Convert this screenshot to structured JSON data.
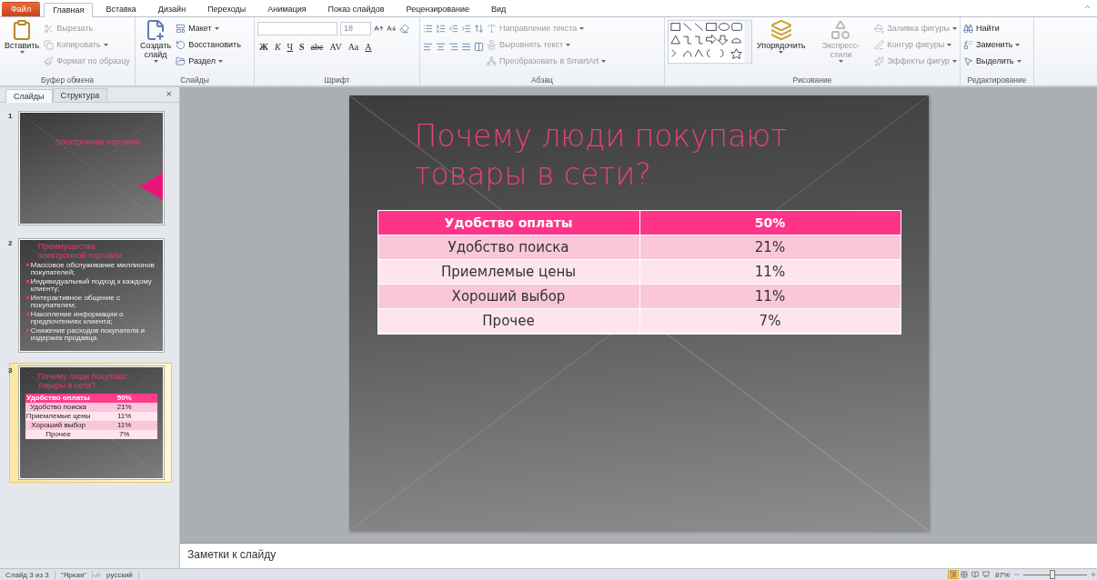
{
  "tabs": [
    {
      "label": "Файл",
      "kind": "file",
      "selected": false
    },
    {
      "label": "Главная",
      "kind": "tab",
      "selected": true
    },
    {
      "label": "Вставка",
      "kind": "tab",
      "selected": false
    },
    {
      "label": "Дизайн",
      "kind": "tab",
      "selected": false
    },
    {
      "label": "Переходы",
      "kind": "tab",
      "selected": false
    },
    {
      "label": "Анимация",
      "kind": "tab",
      "selected": false
    },
    {
      "label": "Показ слайдов",
      "kind": "tab",
      "selected": false
    },
    {
      "label": "Рецензирование",
      "kind": "tab",
      "selected": false
    },
    {
      "label": "Вид",
      "kind": "tab",
      "selected": false
    }
  ],
  "ribbon": {
    "clipboard": {
      "label": "Буфер обмена",
      "paste": "Вставить",
      "items": [
        {
          "label": "Вырезать",
          "kind": "cut",
          "disabled": true,
          "dropdown": false
        },
        {
          "label": "Копировать",
          "kind": "copy",
          "disabled": true,
          "dropdown": true
        },
        {
          "label": "Формат по образцу",
          "kind": "brush",
          "disabled": true,
          "dropdown": false
        }
      ]
    },
    "slides": {
      "label": "Слайды",
      "new_slide": [
        "Создать",
        "слайд"
      ],
      "items": [
        {
          "label": "Макет",
          "kind": "layout",
          "disabled": false,
          "dropdown": true
        },
        {
          "label": "Восстановить",
          "kind": "reset",
          "disabled": false,
          "dropdown": false
        },
        {
          "label": "Раздел",
          "kind": "section",
          "disabled": false,
          "dropdown": true
        }
      ]
    },
    "font": {
      "label": "Шрифт",
      "size": "18",
      "buttons": [
        {
          "label": "Ж",
          "kind": "bold"
        },
        {
          "label": "К",
          "kind": "italic"
        },
        {
          "label": "Ч",
          "kind": "underline"
        },
        {
          "label": "S",
          "kind": "shadow"
        },
        {
          "label": "abc",
          "kind": "strike"
        },
        {
          "label": "AV",
          "kind": "spacing"
        },
        {
          "label": "Aa",
          "kind": "case"
        },
        {
          "label": "A",
          "kind": "color"
        }
      ]
    },
    "paragraph": {
      "label": "Абзац",
      "items": [
        {
          "label": "Направление текста",
          "kind": "direction",
          "disabled": true,
          "dropdown": true
        },
        {
          "label": "Выровнять текст",
          "kind": "align",
          "disabled": true,
          "dropdown": true
        },
        {
          "label": "Преобразовать в SmartArt",
          "kind": "smartart",
          "disabled": true,
          "dropdown": true
        }
      ]
    },
    "drawing": {
      "label": "Рисование",
      "arrange": "Упорядочить",
      "styles": "Экспресс-стили",
      "styles_disabled": true,
      "items": [
        {
          "label": "Заливка фигуры",
          "kind": "fill",
          "disabled": true,
          "dropdown": true
        },
        {
          "label": "Контур фигуры",
          "kind": "outline",
          "disabled": true,
          "dropdown": true
        },
        {
          "label": "Эффекты фигур",
          "kind": "effects",
          "disabled": true,
          "dropdown": true
        }
      ]
    },
    "editing": {
      "label": "Редактирование",
      "items": [
        {
          "label": "Найти",
          "kind": "find",
          "disabled": false,
          "dropdown": false
        },
        {
          "label": "Заменить",
          "kind": "replace",
          "disabled": false,
          "dropdown": true
        },
        {
          "label": "Выделить",
          "kind": "select",
          "disabled": false,
          "dropdown": true
        }
      ]
    }
  },
  "panel": {
    "tabs": [
      {
        "label": "Слайды",
        "selected": true
      },
      {
        "label": "Структура",
        "selected": false
      }
    ],
    "close": "×"
  },
  "thumbnails": [
    {
      "number": "1",
      "selected": false,
      "kind": "title",
      "title": "Электронная торговля"
    },
    {
      "number": "2",
      "selected": false,
      "kind": "bullets",
      "title": "Преимущества электронной торговли",
      "bullets": [
        "Массовое обслуживание миллионов покупателей;",
        "Индивидуальный подход к каждому клиенту;",
        "Интерактивное общение с покупателем;",
        "Накопление информации о предпочтениях клиента;",
        "Снижение расходов покупателя и издержек продавца."
      ]
    },
    {
      "number": "3",
      "selected": true,
      "kind": "table",
      "title": "Почему люди покупают товары в сети?",
      "header": [
        "Удобство оплаты",
        "50%"
      ],
      "rows": [
        [
          "Удобство поиска",
          "21%"
        ],
        [
          "Приемлемые цены",
          "11%"
        ],
        [
          "Хороший выбор",
          "11%"
        ],
        [
          "Прочее",
          "7%"
        ]
      ]
    }
  ],
  "slide": {
    "title": "Почему люди покупают товары в сети?",
    "header": [
      "Удобство оплаты",
      "50%"
    ],
    "rows": [
      [
        "Удобство поиска",
        "21%"
      ],
      [
        "Приемлемые цены",
        "11%"
      ],
      [
        "Хороший выбор",
        "11%"
      ],
      [
        "Прочее",
        "7%"
      ]
    ]
  },
  "notes": {
    "placeholder": "Заметки к слайду"
  },
  "status_bar": {
    "slide": "Слайд 3 из 3",
    "theme": "\"Яркая\"",
    "language": "русский",
    "views": [
      {
        "kind": "normal",
        "selected": true
      },
      {
        "kind": "sorter",
        "selected": false
      },
      {
        "kind": "reading",
        "selected": false
      },
      {
        "kind": "show",
        "selected": false
      }
    ],
    "zoom": "87%",
    "zoom_slider": {
      "level": 0.45
    }
  }
}
